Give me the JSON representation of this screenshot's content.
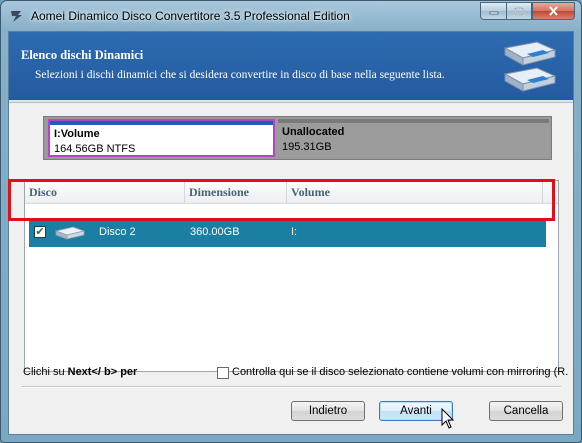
{
  "window": {
    "title": "Aomei Dinamico Disco Convertitore 3.5 Professional Edition"
  },
  "header": {
    "title": "Elenco dischi Dinamici",
    "subtitle": "Selezioni i dischi dinamici che si desidera convertire in disco di base nella seguente lista."
  },
  "partitions": [
    {
      "name": "I:Volume",
      "detail": "164.56GB NTFS"
    },
    {
      "name": "Unallocated",
      "detail": "195.31GB"
    }
  ],
  "list": {
    "columns": [
      "Disco",
      "Dimensione",
      "Volume"
    ],
    "rows": [
      {
        "checked": true,
        "disk": "Disco 2",
        "size": "360.00GB",
        "volume": "I:"
      }
    ]
  },
  "footer": {
    "hint_prefix": "Clichi su ",
    "hint_bold": "Next</ b>",
    "hint_suffix": " per",
    "mirror_label": "Controlla qui se il disco selezionato contiene volumi con mirroring (R."
  },
  "buttons": {
    "back": "Indietro",
    "next": "Avanti",
    "cancel": "Cancella"
  },
  "colors": {
    "header_band": "#2866aa",
    "selected_row": "#1b7fa3",
    "volume_border": "#b545c8",
    "highlight": "#e0101a"
  }
}
